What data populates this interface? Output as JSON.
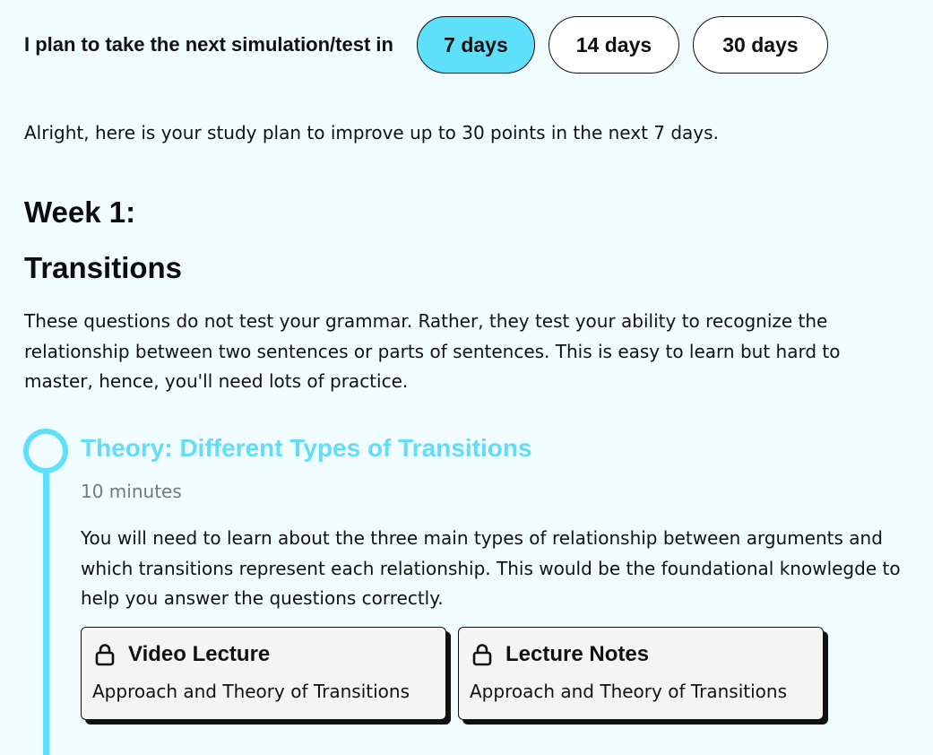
{
  "plan": {
    "label": "I plan to take the next simulation/test in",
    "options": [
      {
        "label": "7 days",
        "selected": true
      },
      {
        "label": "14 days",
        "selected": false
      },
      {
        "label": "30 days",
        "selected": false
      }
    ]
  },
  "intro": "Alright, here is your study plan to improve up to 30 points in the next 7 days.",
  "week": {
    "title": "Week 1:",
    "topic": {
      "title": "Transitions",
      "description": "These questions do not test your grammar. Rather, they test your ability to recognize the relationship between two sentences or parts of sentences. This is easy to learn but hard to master, hence, you'll need lots of practice."
    }
  },
  "steps": [
    {
      "title": "Theory: Different Types of Transitions",
      "duration": "10 minutes",
      "description": "You will need to learn about the three main types of relationship between arguments and which transitions represent each relationship. This would be the foundational knowlegde to help you answer the questions correctly.",
      "resources": [
        {
          "type": "Video Lecture",
          "name": "Approach and Theory of Transitions",
          "icon": "lock-icon"
        },
        {
          "type": "Lecture Notes",
          "name": "Approach and Theory of Transitions",
          "icon": "lock-icon"
        }
      ]
    }
  ],
  "colors": {
    "background": "#f1fcfe",
    "accent": "#5ee0fb",
    "step_title": "#62dcf7",
    "muted_text": "#777777",
    "card_background": "#f4f4f4"
  }
}
